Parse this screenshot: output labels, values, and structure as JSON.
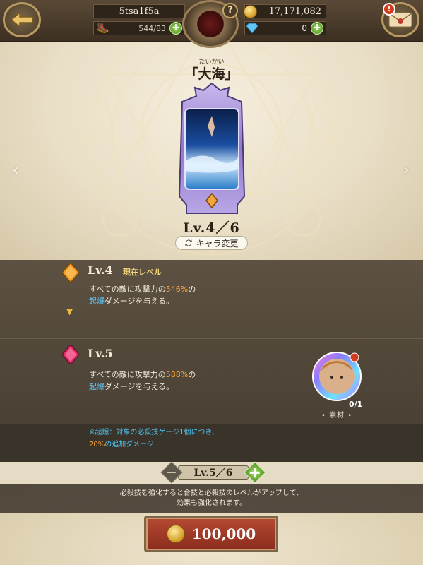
{
  "header": {
    "player_name": "5tsa1f5a",
    "stamina": "544/83",
    "gold": "17,171,082",
    "gems": "0",
    "help_label": "?",
    "mail_alert": "!"
  },
  "title": {
    "ruby": "たいかい",
    "name": "「大海」"
  },
  "level": {
    "current_text": "Lv.4／6",
    "change_label": "キャラ変更"
  },
  "levels": [
    {
      "label": "Lv.4",
      "tag": "現在レベル",
      "line1_prefix": "すべての敵に攻撃力の",
      "line1_value": "546%",
      "line1_suffix": "の",
      "line2_keyword": "起爆",
      "line2_rest": "ダメージを与える。"
    },
    {
      "label": "Lv.5",
      "line1_prefix": "すべての敵に攻撃力の",
      "line1_value": "588%",
      "line1_suffix": "の",
      "line2_keyword": "起爆",
      "line2_rest": "ダメージを与える。"
    }
  ],
  "material": {
    "count": "0/1",
    "label": "素材"
  },
  "note": {
    "line1": "※起爆：対象の必殺技ゲージ1個につき、",
    "line2_value": "20%",
    "line2_rest": "の追加ダメージ"
  },
  "stepper": {
    "value": "Lv.5／6"
  },
  "info": {
    "line1": "必殺技を強化すると合技と必殺技のレベルがアップして、",
    "line2": "効果も強化されます。"
  },
  "purchase": {
    "cost": "100,000"
  },
  "colors": {
    "orange_highlight": "#ffa63a",
    "blue_highlight": "#5ec5f5",
    "button_red": "#b54a33"
  }
}
